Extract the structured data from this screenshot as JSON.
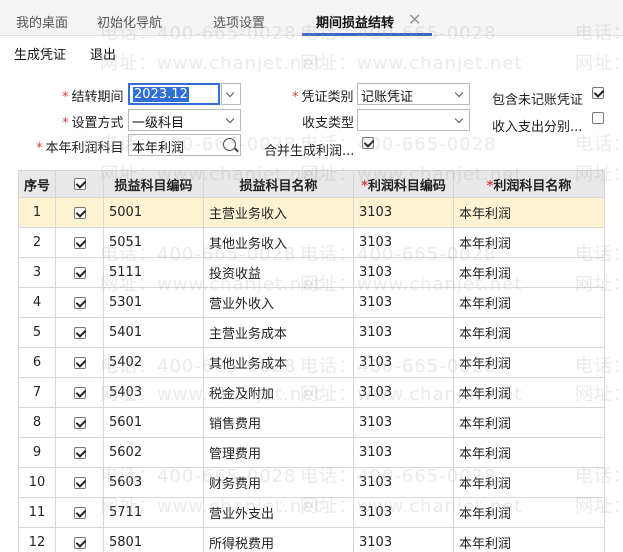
{
  "tabs": [
    {
      "label": "我的桌面",
      "active": false
    },
    {
      "label": "初始化导航",
      "active": false
    },
    {
      "label": "选项设置",
      "active": false
    },
    {
      "label": "期间损益结转",
      "active": true
    }
  ],
  "toolbar": {
    "generate_label": "生成凭证",
    "exit_label": "退出"
  },
  "form": {
    "period_label": "结转期间",
    "period_value": "2023.12",
    "method_label": "设置方式",
    "method_value": "一级科目",
    "profit_account_label": "本年利润科目",
    "profit_account_value": "本年利润",
    "voucher_type_label": "凭证类别",
    "voucher_type_value": "记账凭证",
    "income_type_label": "收支类型",
    "income_type_value": "",
    "merge_label": "合并生成利润...",
    "merge_checked": true,
    "include_unposted_label": "包含未记账凭证",
    "include_unposted_checked": true,
    "split_label": "收入支出分别...",
    "split_checked": false
  },
  "table": {
    "headers": [
      "序号",
      "",
      "损益科目编码",
      "损益科目名称",
      "利润科目编码",
      "利润科目名称"
    ],
    "rows": [
      {
        "idx": "1",
        "code": "5001",
        "name": "主营业务收入",
        "pcode": "3103",
        "pname": "本年利润"
      },
      {
        "idx": "2",
        "code": "5051",
        "name": "其他业务收入",
        "pcode": "3103",
        "pname": "本年利润"
      },
      {
        "idx": "3",
        "code": "5111",
        "name": "投资收益",
        "pcode": "3103",
        "pname": "本年利润"
      },
      {
        "idx": "4",
        "code": "5301",
        "name": "营业外收入",
        "pcode": "3103",
        "pname": "本年利润"
      },
      {
        "idx": "5",
        "code": "5401",
        "name": "主营业务成本",
        "pcode": "3103",
        "pname": "本年利润"
      },
      {
        "idx": "6",
        "code": "5402",
        "name": "其他业务成本",
        "pcode": "3103",
        "pname": "本年利润"
      },
      {
        "idx": "7",
        "code": "5403",
        "name": "税金及附加",
        "pcode": "3103",
        "pname": "本年利润"
      },
      {
        "idx": "8",
        "code": "5601",
        "name": "销售费用",
        "pcode": "3103",
        "pname": "本年利润"
      },
      {
        "idx": "9",
        "code": "5602",
        "name": "管理费用",
        "pcode": "3103",
        "pname": "本年利润"
      },
      {
        "idx": "10",
        "code": "5603",
        "name": "财务费用",
        "pcode": "3103",
        "pname": "本年利润"
      },
      {
        "idx": "11",
        "code": "5711",
        "name": "营业外支出",
        "pcode": "3103",
        "pname": "本年利润"
      },
      {
        "idx": "12",
        "code": "5801",
        "name": "所得税费用",
        "pcode": "3103",
        "pname": "本年利润"
      }
    ]
  },
  "watermark": {
    "phone": "电话：400-665-0028",
    "site": "网址：www.chanjet.net",
    "phone_short": "电话：",
    "site_short": "网址："
  },
  "colors": {
    "accent": "#3a66c4",
    "selected_row": "#fdf3d2",
    "required": "#e03b3b"
  }
}
